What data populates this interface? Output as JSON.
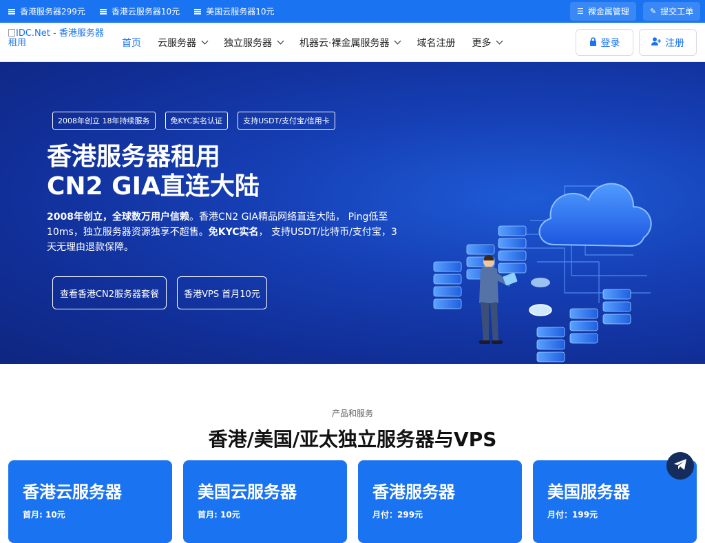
{
  "topbar": {
    "promos": [
      "香港服务器299元",
      "香港云服务器10元",
      "美国云服务器10元"
    ],
    "baremetal_label": "裸金属管理",
    "ticket_label": "提交工单"
  },
  "nav": {
    "logo_alt": "IDC.Net - 香港服务器租用",
    "items": [
      {
        "label": "首页"
      },
      {
        "label": "云服务器"
      },
      {
        "label": "独立服务器"
      },
      {
        "label": "机器云·裸金属服务器"
      },
      {
        "label": "域名注册"
      },
      {
        "label": "更多"
      }
    ],
    "login_label": "登录",
    "register_label": "注册"
  },
  "hero": {
    "badges": [
      "2008年创立 18年持续服务",
      "免KYC实名认证",
      "支持USDT/支付宝/信用卡"
    ],
    "title_line1": "香港服务器租用",
    "title_line2": "CN2 GIA直连大陆",
    "desc_bold1": "2008年创立，全球数万用户信赖",
    "desc_part1": "。香港CN2 GIA精品网络直连大陆， Ping低至10ms，独立服务器资源独享不超售。",
    "desc_bold2": "免KYC实名",
    "desc_part2": "， 支持USDT/比特币/支付宝，3天无理由退款保障。",
    "cta_primary": "查看香港CN2服务器套餐",
    "cta_secondary": "香港VPS 首月10元"
  },
  "products": {
    "subtitle": "产品和服务",
    "title": "香港/美国/亚太独立服务器与VPS",
    "cards": [
      {
        "name": "香港云服务器",
        "price": "首月: 10元"
      },
      {
        "name": "美国云服务器",
        "price": "首月: 10元"
      },
      {
        "name": "香港服务器",
        "price": "月付：299元"
      },
      {
        "name": "美国服务器",
        "price": "月付：199元"
      }
    ]
  },
  "colors": {
    "accent": "#1a73f0",
    "hero_bg": "#1640b6",
    "telegram_bg": "#142d5c"
  }
}
